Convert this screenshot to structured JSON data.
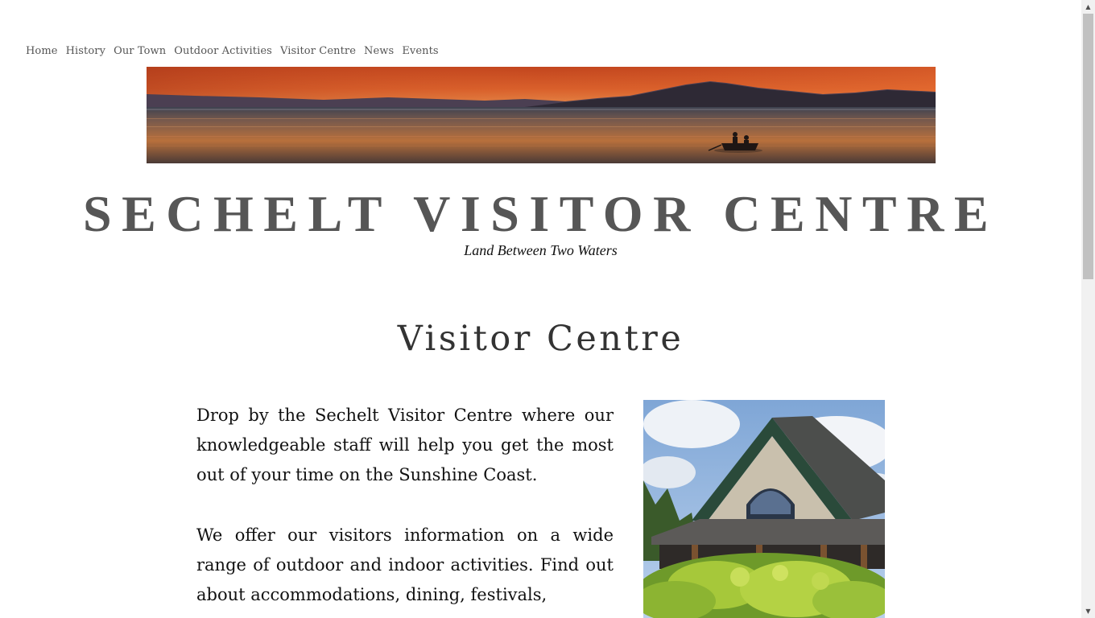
{
  "nav": {
    "items": [
      {
        "label": "Home"
      },
      {
        "label": "History"
      },
      {
        "label": "Our Town"
      },
      {
        "label": "Outdoor Activities"
      },
      {
        "label": "Visitor Centre"
      },
      {
        "label": "News"
      },
      {
        "label": "Events"
      }
    ]
  },
  "site": {
    "title": "SECHELT VISITOR CENTRE",
    "tagline": "Land Between Two Waters"
  },
  "main": {
    "heading": "Visitor Centre",
    "paragraphs": [
      "Drop by the Sechelt Visitor Centre where our knowledgeable staff will help you get the most out of your time on the Sunshine Coast.",
      "We offer our visitors information on a wide range of outdoor and indoor activities. Find out about accommodations, dining, festivals,"
    ]
  },
  "colors": {
    "title": "#565656",
    "nav": "#555555",
    "sunset": "#e0642a"
  },
  "icons": {
    "scroll_up": "triangle-up",
    "scroll_down": "triangle-down"
  }
}
